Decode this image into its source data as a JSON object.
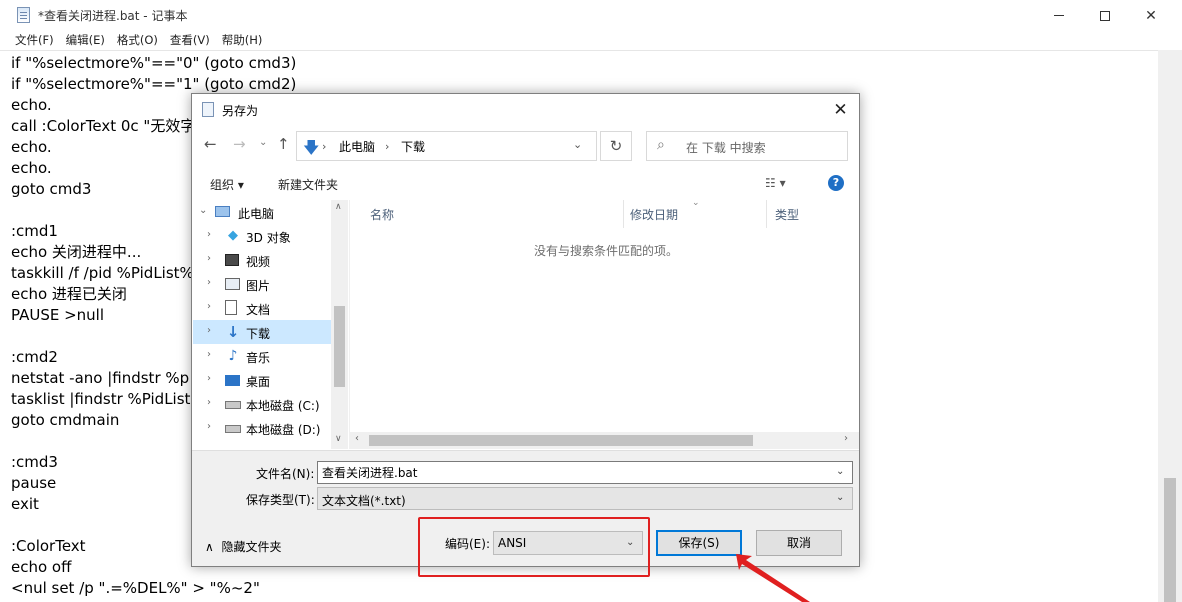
{
  "notepad": {
    "title": "*查看关闭进程.bat - 记事本",
    "menu": [
      "文件(F)",
      "编辑(E)",
      "格式(O)",
      "查看(V)",
      "帮助(H)"
    ],
    "lines": [
      "if \"%selectmore%\"==\"0\" (goto cmd3)",
      "if \"%selectmore%\"==\"1\" (goto cmd2)",
      "echo.",
      "call :ColorText 0c \"无效字",
      "echo.",
      "echo.",
      "goto cmd3",
      "",
      ":cmd1",
      "echo 关闭进程中...",
      "taskkill /f /pid %PidList%",
      "echo 进程已关闭",
      "PAUSE >null",
      "",
      ":cmd2",
      "netstat -ano |findstr %p",
      "tasklist |findstr %PidList%",
      "goto cmdmain",
      "",
      ":cmd3",
      "pause",
      "exit",
      "",
      ":ColorText",
      "echo off",
      "<nul set /p \".=%DEL%\" > \"%~2\""
    ]
  },
  "dialog": {
    "title": "另存为",
    "address": {
      "segments": [
        "此电脑",
        "下载"
      ]
    },
    "search_placeholder": "在 下载 中搜索",
    "toolbar": {
      "organize": "组织 ▾",
      "new_folder": "新建文件夹"
    },
    "tree": [
      {
        "label": "此电脑",
        "icon": "computer-icon",
        "root": true
      },
      {
        "label": "3D 对象",
        "icon": "3d-objects-icon"
      },
      {
        "label": "视频",
        "icon": "video-folder-icon"
      },
      {
        "label": "图片",
        "icon": "pictures-folder-icon"
      },
      {
        "label": "文档",
        "icon": "documents-folder-icon"
      },
      {
        "label": "下载",
        "icon": "downloads-folder-icon",
        "selected": true
      },
      {
        "label": "音乐",
        "icon": "music-folder-icon"
      },
      {
        "label": "桌面",
        "icon": "desktop-folder-icon"
      },
      {
        "label": "本地磁盘 (C:)",
        "icon": "drive-icon"
      },
      {
        "label": "本地磁盘 (D:)",
        "icon": "drive-icon"
      }
    ],
    "columns": [
      "名称",
      "修改日期",
      "类型"
    ],
    "empty_message": "没有与搜索条件匹配的项。",
    "file_name_label": "文件名(N):",
    "file_name_value": "查看关闭进程.bat",
    "save_type_label": "保存类型(T):",
    "save_type_value": "文本文档(*.txt)",
    "hide_folders": "隐藏文件夹",
    "encoding_label": "编码(E):",
    "encoding_value": "ANSI",
    "save_button": "保存(S)",
    "cancel_button": "取消"
  },
  "colors": {
    "annotation": "#e02020",
    "selection": "#cce8ff",
    "accent": "#0078d7"
  }
}
